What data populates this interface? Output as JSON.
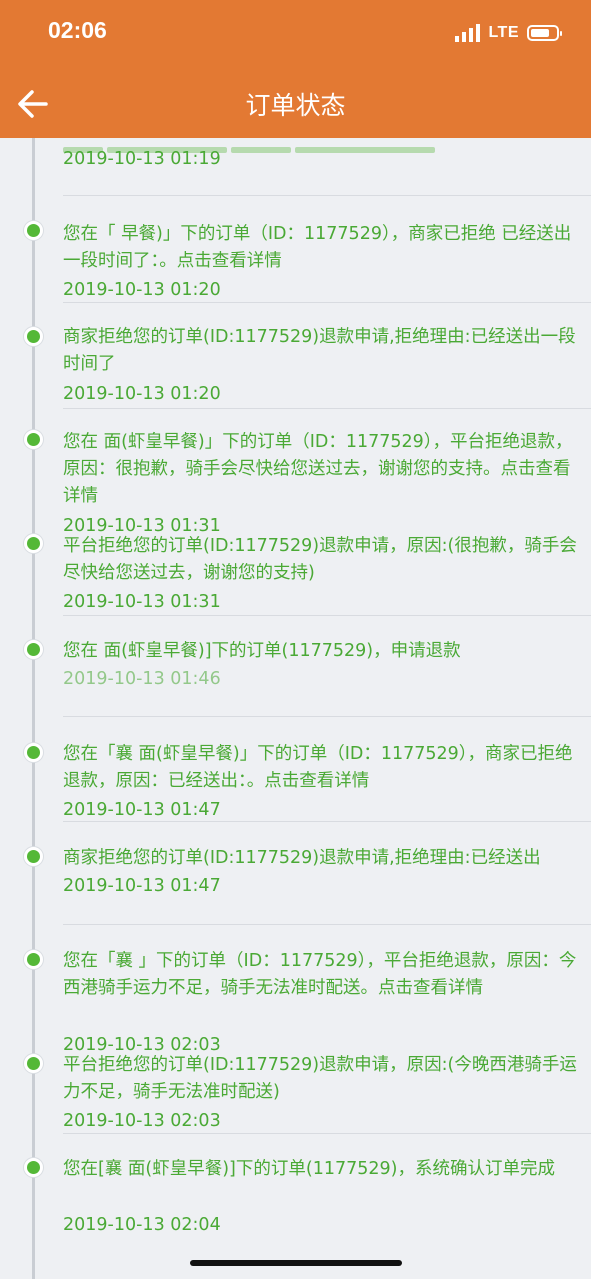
{
  "status_bar": {
    "time": "02:06",
    "network": "LTE"
  },
  "header": {
    "title": "订单状态"
  },
  "entries": [
    {
      "msg": "",
      "time": "2019-10-13 01:19"
    },
    {
      "msg": "您在「                  早餐)」下的订单（ID：1177529），商家已拒绝               已经送出一段时间了：。点击查看详情",
      "time": "2019-10-13 01:20"
    },
    {
      "msg": "商家拒绝您的订单(ID:1177529)退款申请,拒绝理由:已经送出一段时间了",
      "time": "2019-10-13 01:20"
    },
    {
      "msg": "您在              面(虾皇早餐)」下的订单（ID：1177529），平台拒绝退款，原因：很抱歉，骑手会尽快给您送过去，谢谢您的支持。点击查看详情",
      "time": "2019-10-13 01:31"
    },
    {
      "msg": "平台拒绝您的订单(ID:1177529)退款申请，原因:(很抱歉，骑手会尽快给您送过去，谢谢您的支持)",
      "time": "2019-10-13 01:31"
    },
    {
      "msg": "您在              面(虾皇早餐)]下的订单(1177529)，申请退款",
      "time": "2019-10-13 01:46"
    },
    {
      "msg": "您在「襄            面(虾皇早餐)」下的订单（ID：1177529），商家已拒绝退款，原因：已经送出：。点击查看详情",
      "time": "2019-10-13 01:47"
    },
    {
      "msg": "商家拒绝您的订单(ID:1177529)退款申请,拒绝理由:已经送出",
      "time": "2019-10-13 01:47"
    },
    {
      "msg": "您在「襄                        」下的订单（ID：1177529），平台拒绝退款，原因：今    西港骑手运力不足，骑手无法准时配送。点击查看详情",
      "time": "2019-10-13 02:03"
    },
    {
      "msg": "平台拒绝您的订单(ID:1177529)退款申请，原因:(今晚西港骑手运力不足，骑手无法准时配送)",
      "time": "2019-10-13 02:03"
    },
    {
      "msg": "您在[襄            面(虾皇早餐)]下的订单(1177529)，系统确认订单完成",
      "time": "2019-10-13 02:04"
    }
  ]
}
